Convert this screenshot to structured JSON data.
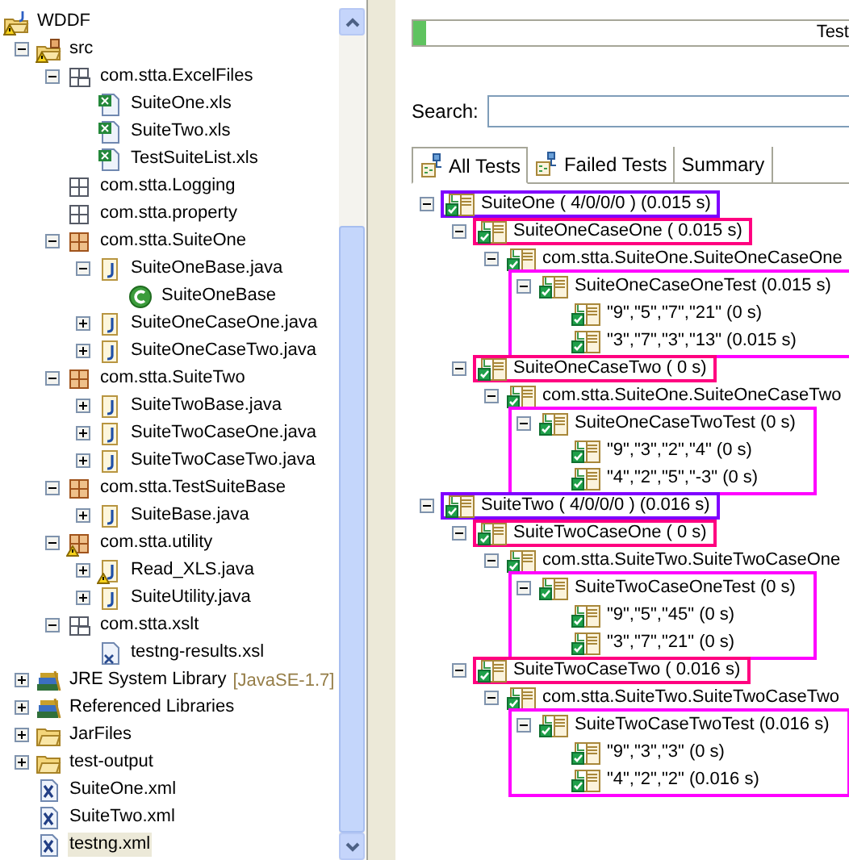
{
  "project_tree": [
    {
      "label": "WDDF",
      "kind": "project",
      "warning": true,
      "selected": false,
      "children": [
        {
          "label": "src",
          "kind": "source-folder",
          "warning": true,
          "selected": false,
          "expanded": true,
          "children": [
            {
              "label": "com.stta.ExcelFiles",
              "kind": "folder-package",
              "warning": false,
              "selected": false,
              "expanded": true,
              "children": [
                {
                  "label": "SuiteOne.xls",
                  "kind": "xls",
                  "warning": false,
                  "selected": false
                },
                {
                  "label": "SuiteTwo.xls",
                  "kind": "xls",
                  "warning": false,
                  "selected": false
                },
                {
                  "label": "TestSuiteList.xls",
                  "kind": "xls",
                  "warning": false,
                  "selected": false
                }
              ]
            },
            {
              "label": "com.stta.Logging",
              "kind": "empty-package",
              "warning": false,
              "selected": false
            },
            {
              "label": "com.stta.property",
              "kind": "empty-package",
              "warning": false,
              "selected": false
            },
            {
              "label": "com.stta.SuiteOne",
              "kind": "package",
              "warning": false,
              "selected": false,
              "expanded": true,
              "children": [
                {
                  "label": "SuiteOneBase.java",
                  "kind": "java",
                  "warning": false,
                  "selected": false,
                  "expanded": true,
                  "children": [
                    {
                      "label": "SuiteOneBase",
                      "kind": "class",
                      "warning": false,
                      "selected": false
                    }
                  ]
                },
                {
                  "label": "SuiteOneCaseOne.java",
                  "kind": "java",
                  "warning": false,
                  "selected": false,
                  "expanded": false
                },
                {
                  "label": "SuiteOneCaseTwo.java",
                  "kind": "java",
                  "warning": false,
                  "selected": false,
                  "expanded": false
                }
              ]
            },
            {
              "label": "com.stta.SuiteTwo",
              "kind": "package",
              "warning": false,
              "selected": false,
              "expanded": true,
              "children": [
                {
                  "label": "SuiteTwoBase.java",
                  "kind": "java",
                  "warning": false,
                  "selected": false,
                  "expanded": false
                },
                {
                  "label": "SuiteTwoCaseOne.java",
                  "kind": "java",
                  "warning": false,
                  "selected": false,
                  "expanded": false
                },
                {
                  "label": "SuiteTwoCaseTwo.java",
                  "kind": "java",
                  "warning": false,
                  "selected": false,
                  "expanded": false
                }
              ]
            },
            {
              "label": "com.stta.TestSuiteBase",
              "kind": "package",
              "warning": false,
              "selected": false,
              "expanded": true,
              "children": [
                {
                  "label": "SuiteBase.java",
                  "kind": "java",
                  "warning": false,
                  "selected": false,
                  "expanded": false
                }
              ]
            },
            {
              "label": "com.stta.utility",
              "kind": "package",
              "warning": true,
              "selected": false,
              "expanded": true,
              "children": [
                {
                  "label": "Read_XLS.java",
                  "kind": "java",
                  "warning": true,
                  "selected": false,
                  "expanded": false
                },
                {
                  "label": "SuiteUtility.java",
                  "kind": "java",
                  "warning": false,
                  "selected": false,
                  "expanded": false
                }
              ]
            },
            {
              "label": "com.stta.xslt",
              "kind": "folder-package",
              "warning": false,
              "selected": false,
              "expanded": true,
              "children": [
                {
                  "label": "testng-results.xsl",
                  "kind": "xsl",
                  "warning": false,
                  "selected": false
                }
              ]
            }
          ]
        },
        {
          "label": "JRE System Library",
          "decoration": "[JavaSE-1.7]",
          "kind": "library",
          "warning": false,
          "selected": false,
          "expanded": false
        },
        {
          "label": "Referenced Libraries",
          "kind": "library",
          "warning": false,
          "selected": false,
          "expanded": false
        },
        {
          "label": "JarFiles",
          "kind": "folder",
          "warning": false,
          "selected": false,
          "expanded": false
        },
        {
          "label": "test-output",
          "kind": "folder",
          "warning": false,
          "selected": false,
          "expanded": false
        },
        {
          "label": "SuiteOne.xml",
          "kind": "xml",
          "warning": false,
          "selected": false
        },
        {
          "label": "SuiteTwo.xml",
          "kind": "xml",
          "warning": false,
          "selected": false
        },
        {
          "label": "testng.xml",
          "kind": "xml",
          "warning": false,
          "selected": true
        }
      ]
    }
  ],
  "progress": {
    "level": 0.03,
    "label": "Test"
  },
  "search": {
    "label": "Search:"
  },
  "tabs": [
    {
      "label": "All Tests",
      "kind": "icon-tab",
      "selected": true
    },
    {
      "label": "Failed Tests",
      "kind": "icon-tab",
      "selected": false
    },
    {
      "label": "Summary",
      "kind": "text-tab",
      "selected": false
    }
  ],
  "test_tree": [
    {
      "label": "SuiteOne ( 4/0/0/0 ) (0.015 s)",
      "kind": "suite",
      "expanded": true,
      "color": "#8000ff",
      "children": [
        {
          "label": "SuiteOneCaseOne ( 0.015 s)",
          "kind": "case",
          "expanded": true,
          "color": "#ff0080",
          "children": [
            {
              "label": "com.stta.SuiteOne.SuiteOneCaseOne",
              "expanded": true,
              "children": [
                {
                  "label": "SuiteOneCaseOneTest  (0.015 s)",
                  "kind": "method",
                  "expanded": true,
                  "color": "#ff00ff",
                  "children": [
                    {
                      "label": "\"9\",\"5\",\"7\",\"21\"  (0 s)"
                    },
                    {
                      "label": "\"3\",\"7\",\"3\",\"13\"  (0.015 s)"
                    }
                  ]
                }
              ]
            }
          ]
        },
        {
          "label": "SuiteOneCaseTwo ( 0 s)",
          "kind": "case",
          "expanded": true,
          "color": "#ff0080",
          "children": [
            {
              "label": "com.stta.SuiteOne.SuiteOneCaseTwo",
              "expanded": true,
              "children": [
                {
                  "label": "SuiteOneCaseTwoTest  (0 s)",
                  "kind": "method",
                  "expanded": true,
                  "color": "#ff00ff",
                  "children": [
                    {
                      "label": "\"9\",\"3\",\"2\",\"4\"  (0 s)"
                    },
                    {
                      "label": "\"4\",\"2\",\"5\",\"-3\"  (0 s)"
                    }
                  ]
                }
              ]
            }
          ]
        }
      ]
    },
    {
      "label": "SuiteTwo ( 4/0/0/0 ) (0.016 s)",
      "kind": "suite",
      "expanded": true,
      "color": "#8000ff",
      "children": [
        {
          "label": "SuiteTwoCaseOne ( 0 s)",
          "kind": "case",
          "expanded": true,
          "color": "#ff0080",
          "children": [
            {
              "label": "com.stta.SuiteTwo.SuiteTwoCaseOne",
              "expanded": true,
              "children": [
                {
                  "label": "SuiteTwoCaseOneTest  (0 s)",
                  "kind": "method",
                  "expanded": true,
                  "color": "#ff00ff",
                  "children": [
                    {
                      "label": "\"9\",\"5\",\"45\"  (0 s)"
                    },
                    {
                      "label": "\"3\",\"7\",\"21\"  (0 s)"
                    }
                  ]
                }
              ]
            }
          ]
        },
        {
          "label": "SuiteTwoCaseTwo ( 0.016 s)",
          "kind": "case",
          "expanded": true,
          "color": "#ff0080",
          "children": [
            {
              "label": "com.stta.SuiteTwo.SuiteTwoCaseTwo",
              "expanded": true,
              "children": [
                {
                  "label": "SuiteTwoCaseTwoTest  (0.016 s)",
                  "kind": "method",
                  "expanded": true,
                  "color": "#ff00ff",
                  "children": [
                    {
                      "label": "\"9\",\"3\",\"3\"  (0 s)"
                    },
                    {
                      "label": "\"4\",\"2\",\"2\"  (0.016 s)"
                    }
                  ]
                }
              ]
            }
          ]
        }
      ]
    }
  ]
}
